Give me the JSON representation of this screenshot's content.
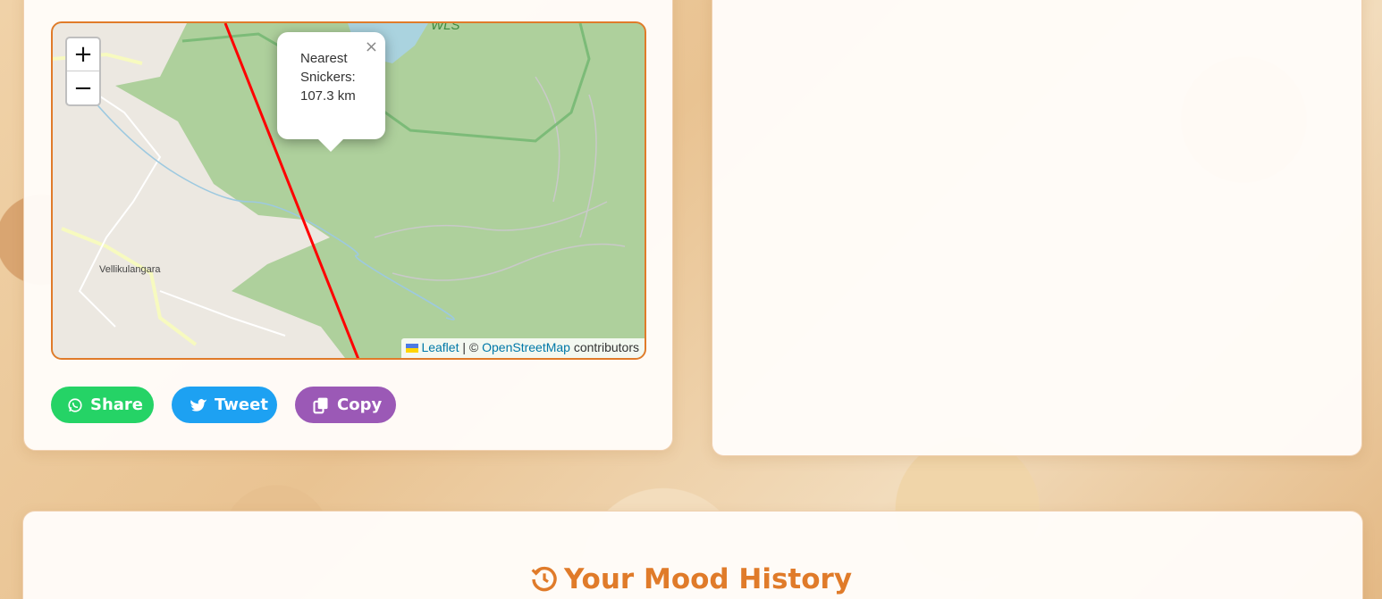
{
  "map": {
    "popup_text": "Nearest Snickers: 107.3 km",
    "popup_close": "×",
    "zoom_in": "+",
    "zoom_out": "−",
    "place_label": "Vellikulangara",
    "area_label": "WLS",
    "attribution": {
      "leaflet": "Leaflet",
      "separator": " | © ",
      "osm": "OpenStreetMap",
      "suffix": " contributors"
    },
    "route_color": "#ff0000"
  },
  "share": {
    "share_label": "Share",
    "tweet_label": "Tweet",
    "copy_label": "Copy"
  },
  "history": {
    "title": "Your Mood History"
  },
  "colors": {
    "accent": "#e07b2a",
    "whatsapp": "#25d366",
    "twitter": "#1da1f2",
    "copy": "#9b59b6"
  },
  "icons": [
    "whatsapp-icon",
    "twitter-icon",
    "copy-icon",
    "history-icon",
    "close-icon"
  ]
}
